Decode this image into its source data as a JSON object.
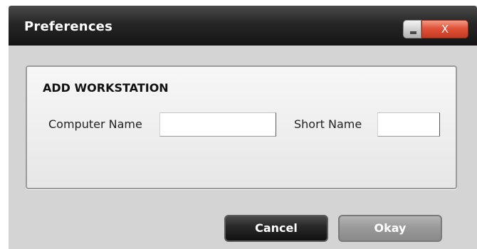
{
  "window": {
    "title": "Preferences",
    "close_label": "X"
  },
  "group": {
    "title": "ADD WORKSTATION",
    "computer_name_label": "Computer Name",
    "computer_name_value": "",
    "short_name_label": "Short Name",
    "short_name_value": ""
  },
  "buttons": {
    "cancel": "Cancel",
    "okay": "Okay"
  },
  "icons": {
    "minimize": "minimize-icon",
    "close": "close-icon"
  },
  "colors": {
    "titlebar": "#1a1a1a",
    "close_button": "#d9472d",
    "panel_background": "#d4d4d4"
  }
}
